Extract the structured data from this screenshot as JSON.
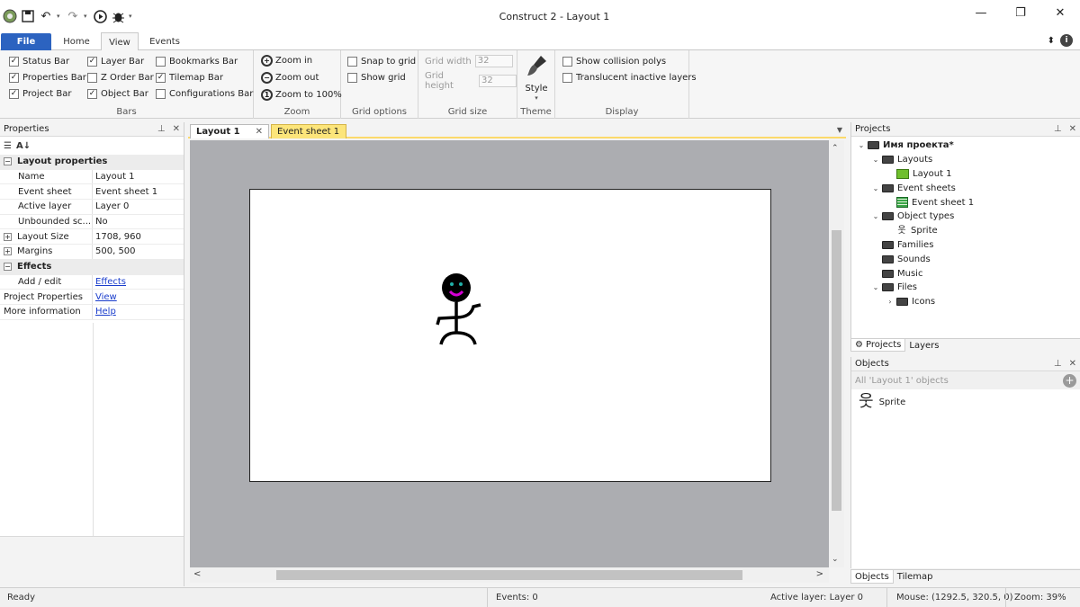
{
  "window": {
    "title": "Construct 2 - Layout 1"
  },
  "ribbon_tabs": {
    "file": "File",
    "home": "Home",
    "view": "View",
    "events": "Events"
  },
  "bars_group": {
    "label": "Bars",
    "items": [
      {
        "label": "Status Bar",
        "checked": true
      },
      {
        "label": "Properties Bar",
        "checked": true
      },
      {
        "label": "Project Bar",
        "checked": true
      },
      {
        "label": "Layer Bar",
        "checked": true
      },
      {
        "label": "Z Order Bar",
        "checked": false
      },
      {
        "label": "Object Bar",
        "checked": true
      },
      {
        "label": "Bookmarks Bar",
        "checked": false
      },
      {
        "label": "Tilemap Bar",
        "checked": true
      },
      {
        "label": "Configurations Bar",
        "checked": false
      }
    ]
  },
  "zoom_group": {
    "label": "Zoom",
    "zoom_in": "Zoom in",
    "zoom_out": "Zoom out",
    "zoom_100": "Zoom to 100%"
  },
  "grid_options": {
    "label": "Grid options",
    "snap": "Snap to grid",
    "show": "Show grid"
  },
  "grid_size": {
    "label": "Grid size",
    "width_label": "Grid width",
    "width": "32",
    "height_label": "Grid height",
    "height": "32"
  },
  "theme": {
    "label": "Theme",
    "style": "Style"
  },
  "display": {
    "label": "Display",
    "collision": "Show collision polys",
    "translucent": "Translucent inactive layers"
  },
  "properties": {
    "title": "Properties",
    "category_layout": "Layout properties",
    "rows": [
      {
        "key": "Name",
        "value": "Layout 1"
      },
      {
        "key": "Event sheet",
        "value": "Event sheet 1"
      },
      {
        "key": "Active layer",
        "value": "Layer 0"
      },
      {
        "key": "Unbounded sc...",
        "value": "No"
      },
      {
        "key": "Layout Size",
        "value": "1708, 960"
      },
      {
        "key": "Margins",
        "value": "500, 500"
      }
    ],
    "category_effects": "Effects",
    "add_edit_key": "Add / edit",
    "add_edit_value": "Effects",
    "project_props_key": "Project Properties",
    "project_props_value": "View",
    "more_info_key": "More information",
    "more_info_value": "Help"
  },
  "doc_tabs": {
    "layout": "Layout 1",
    "event_sheet": "Event sheet 1"
  },
  "projects": {
    "title": "Projects",
    "root": "Имя проекта*",
    "layouts": "Layouts",
    "layout1": "Layout 1",
    "event_sheets": "Event sheets",
    "event_sheet1": "Event sheet 1",
    "object_types": "Object types",
    "sprite": "Sprite",
    "families": "Families",
    "sounds": "Sounds",
    "music": "Music",
    "files": "Files",
    "icons": "Icons"
  },
  "project_tabs": {
    "projects": "Projects",
    "layers": "Layers"
  },
  "objects": {
    "title": "Objects",
    "filter": "All 'Layout 1' objects",
    "item": "Sprite"
  },
  "object_tabs": {
    "objects": "Objects",
    "tilemap": "Tilemap"
  },
  "status": {
    "ready": "Ready",
    "events": "Events: 0",
    "active_layer": "Active layer: Layer 0",
    "mouse": "Mouse: (1292.5, 320.5, 0)",
    "zoom": "Zoom: 39%"
  },
  "colors": {
    "file_tab": "#2c63c0",
    "event_tab": "#fce57a",
    "canvas_bg": "#acadb1",
    "smile": "#d400d4",
    "eyes": "#21b0a8"
  }
}
